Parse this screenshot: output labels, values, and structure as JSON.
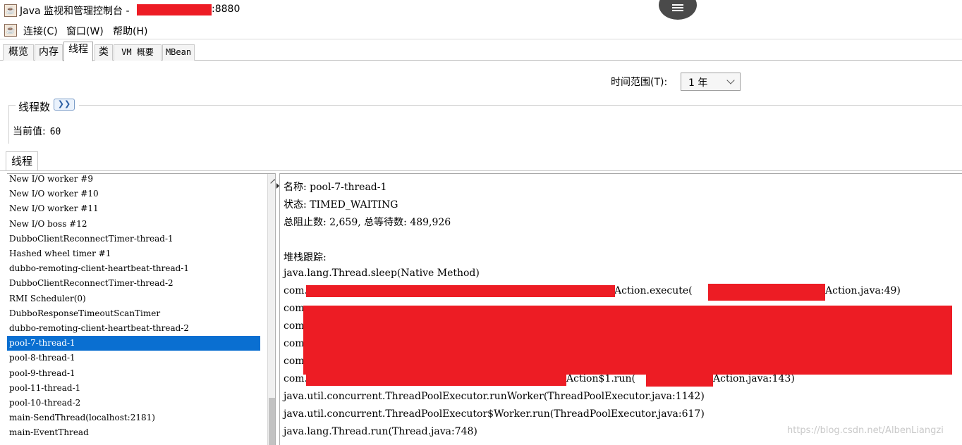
{
  "window": {
    "title": "Java 监视和管理控制台 -",
    "port_suffix": ":8880"
  },
  "menubar": {
    "items": [
      "连接(C)",
      "窗口(W)",
      "帮助(H)"
    ]
  },
  "tabs": [
    "概览",
    "内存",
    "线程",
    "类",
    "VM 概要",
    "MBean"
  ],
  "active_tab": "线程",
  "time_range": {
    "label": "时间范围(T):",
    "value": "1 年"
  },
  "thread_count": {
    "title": "线程数",
    "current_label": "当前值:",
    "current_value": "60"
  },
  "threads_panel": {
    "tab_label": "线程",
    "threads": [
      "New I/O worker #9",
      "New I/O worker #10",
      "New I/O worker #11",
      "New I/O boss #12",
      "DubboClientReconnectTimer-thread-1",
      "Hashed wheel timer #1",
      "dubbo-remoting-client-heartbeat-thread-1",
      "DubboClientReconnectTimer-thread-2",
      "RMI Scheduler(0)",
      "DubboResponseTimeoutScanTimer",
      "dubbo-remoting-client-heartbeat-thread-2",
      "pool-7-thread-1",
      "pool-8-thread-1",
      "pool-9-thread-1",
      "pool-11-thread-1",
      "pool-10-thread-2",
      "main-SendThread(localhost:2181)",
      "main-EventThread"
    ],
    "selected_index": 11
  },
  "details": {
    "name_line": "名称: pool-7-thread-1",
    "state_line": "状态: TIMED_WAITING",
    "counts_line": "总阻止数: 2,659, 总等待数: 489,926",
    "stack_label": "堆栈跟踪:",
    "stack": [
      "java.lang.Thread.sleep(Native Method)",
      "com.",
      "Action.execute(",
      "Action.java:49)",
      "com.",
      "com.",
      "com.",
      "com.",
      "com.",
      "Action$1.run(",
      "Action.java:143)",
      "java.util.concurrent.ThreadPoolExecutor.runWorker(ThreadPoolExecutor.java:1142)",
      "java.util.concurrent.ThreadPoolExecutor$Worker.run(ThreadPoolExecutor.java:617)",
      "java.lang.Thread.run(Thread.java:748)"
    ]
  },
  "watermark": "https://blog.csdn.net/AlbenLiangzi",
  "colors": {
    "redaction": "#ed1c24",
    "selection": "#0a6fd1"
  },
  "icons": [
    "java-icon",
    "java-icon",
    "collapse-icon",
    "chevron-down-icon",
    "scroll-up-icon",
    "split-arrow-icon",
    "hamburger-icon"
  ]
}
